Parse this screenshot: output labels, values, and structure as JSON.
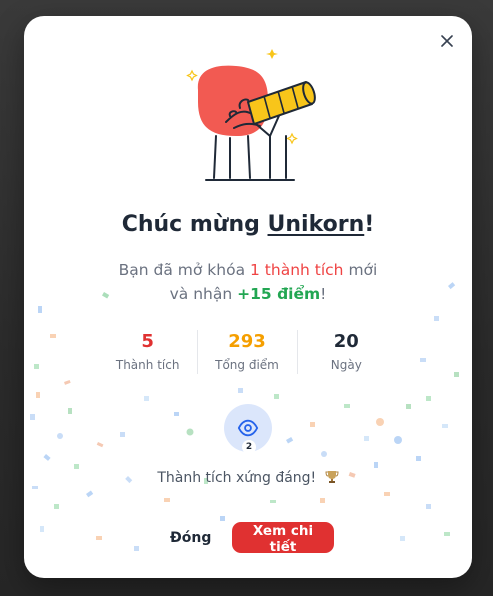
{
  "dialog": {
    "close_icon": "close-icon",
    "illustration": "telescope-illustration",
    "title_prefix": "Chúc mừng ",
    "username": "Unikorn",
    "title_suffix": "!",
    "subtitle": {
      "part1": "Bạn đã mở khóa ",
      "highlight": "1 thành tích",
      "part2": " mới",
      "part3": "và nhận ",
      "points": "+15 điểm",
      "part4": "!"
    },
    "stats": [
      {
        "value": "5",
        "label": "Thành tích",
        "color": "#e03131"
      },
      {
        "value": "293",
        "label": "Tổng điểm",
        "color": "#f59f00"
      },
      {
        "value": "20",
        "label": "Ngày",
        "color": "#1f2937"
      }
    ],
    "badge": {
      "icon": "eye-icon",
      "count": "2"
    },
    "praise_text": "Thành tích xứng đáng!",
    "praise_icon": "trophy-icon",
    "buttons": {
      "close_label": "Đóng",
      "detail_label": "Xem chi tiết"
    }
  },
  "colors": {
    "accent": "#e03131",
    "points": "#22a652",
    "orange": "#f59f00",
    "blob": "#f25a52",
    "telescope": "#f8c51a"
  }
}
